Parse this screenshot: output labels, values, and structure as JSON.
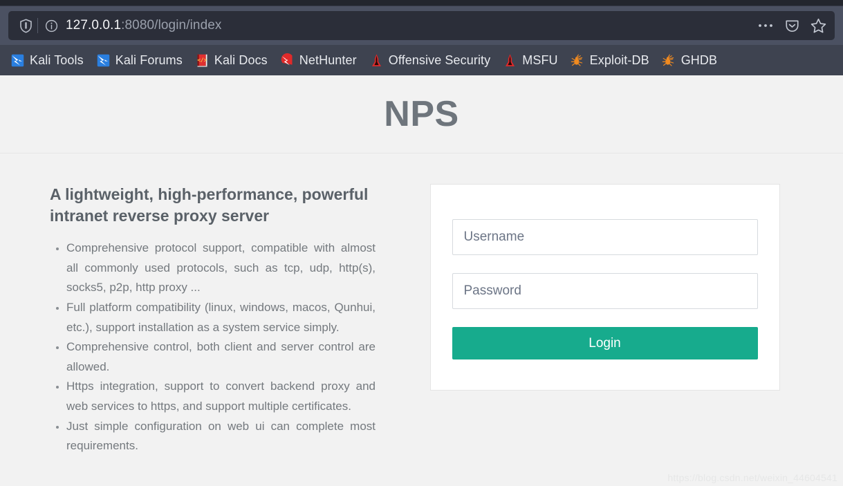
{
  "browser": {
    "url_host": "127.0.0.1",
    "url_rest": ":8080/login/index",
    "shield_icon": "shield-icon",
    "info_icon": "info-circle-icon",
    "actions": [
      {
        "name": "page-actions-ellipsis-icon",
        "label": "…"
      },
      {
        "name": "pocket-icon",
        "label": ""
      },
      {
        "name": "bookmark-star-icon",
        "label": ""
      }
    ],
    "bookmarks": [
      {
        "label": "Kali Tools",
        "icon": "kali-dragon-icon"
      },
      {
        "label": "Kali Forums",
        "icon": "kali-dragon-icon"
      },
      {
        "label": "Kali Docs",
        "icon": "kali-docs-book-icon"
      },
      {
        "label": "NetHunter",
        "icon": "nethunter-icon"
      },
      {
        "label": "Offensive Security",
        "icon": "offsec-icon"
      },
      {
        "label": "MSFU",
        "icon": "offsec-icon"
      },
      {
        "label": "Exploit-DB",
        "icon": "exploitdb-spider-icon"
      },
      {
        "label": "GHDB",
        "icon": "exploitdb-spider-icon"
      }
    ]
  },
  "page": {
    "title": "NPS",
    "intro_heading": "A lightweight, high-performance, powerful intranet reverse proxy server",
    "features": [
      "Comprehensive protocol support, compatible with almost all commonly used protocols, such as tcp, udp, http(s), socks5, p2p, http proxy ...",
      "Full platform compatibility (linux, windows, macos, Qunhui, etc.), support installation as a system service simply.",
      "Comprehensive control, both client and server control are allowed.",
      "Https integration, support to convert backend proxy and web services to https, and support multiple certificates.",
      "Just simple configuration on web ui can complete most requirements."
    ],
    "login": {
      "username_placeholder": "Username",
      "username_value": "",
      "password_placeholder": "Password",
      "password_value": "",
      "login_label": "Login"
    },
    "watermark": "https://blog.csdn.net/weixin_44604541"
  },
  "colors": {
    "accent_teal": "#17ab8d",
    "chrome_bg": "#4b5162",
    "bookmarks_bg": "#3e4350",
    "urlbar_bg": "#2b2e39",
    "page_bg": "#f2f2f2",
    "title_gray": "#6e757c"
  }
}
